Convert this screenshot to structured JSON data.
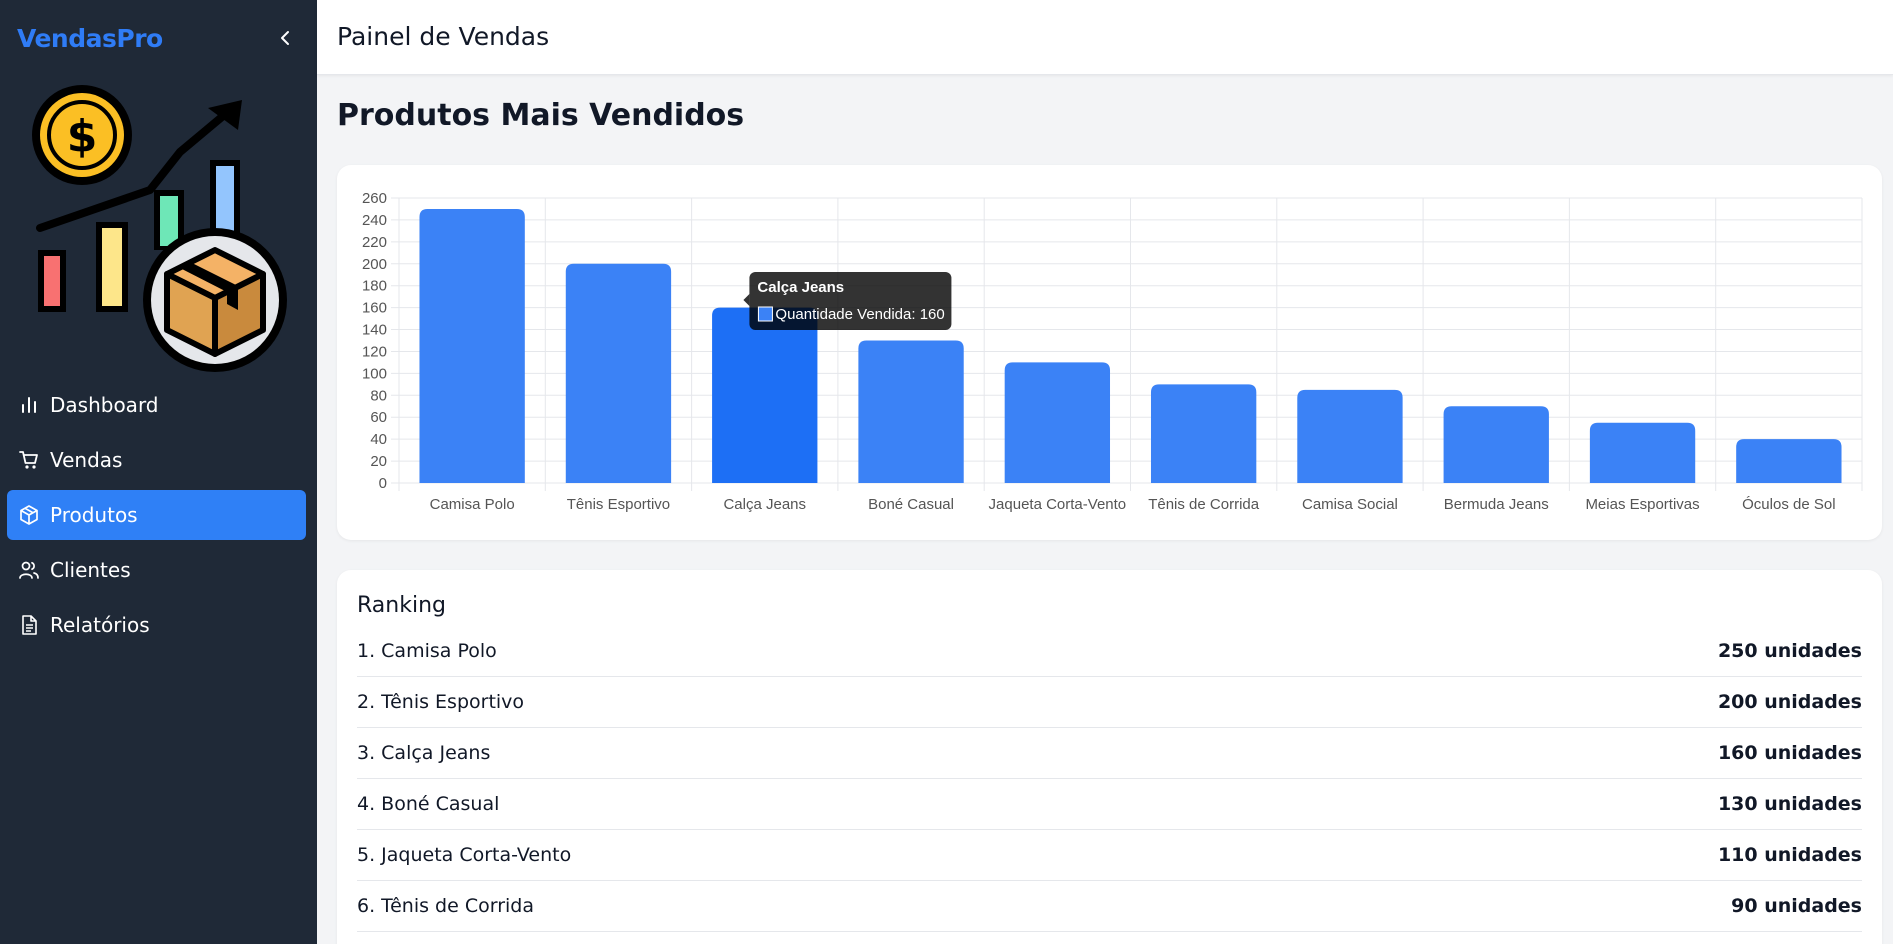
{
  "app": {
    "brand": "VendasPro",
    "header_title": "Painel de Vendas"
  },
  "icons": {
    "collapse": "chevron-left-icon",
    "logo": "sales-growth-logo-icon"
  },
  "colors": {
    "brand": "#2f7cf6",
    "sidebar_bg": "#1f2937",
    "active_nav": "#2f80f6",
    "bar": "#3b82f6",
    "bar_hover": "#1d6ff5"
  },
  "sidebar": {
    "items": [
      {
        "label": "Dashboard",
        "icon": "bar-chart-icon",
        "active": false
      },
      {
        "label": "Vendas",
        "icon": "cart-icon",
        "active": false
      },
      {
        "label": "Produtos",
        "icon": "package-icon",
        "active": true
      },
      {
        "label": "Clientes",
        "icon": "users-icon",
        "active": false
      },
      {
        "label": "Relatórios",
        "icon": "file-text-icon",
        "active": false
      }
    ]
  },
  "main": {
    "page_title": "Produtos Mais Vendidos"
  },
  "chart_data": {
    "type": "bar",
    "categories": [
      "Camisa Polo",
      "Tênis Esportivo",
      "Calça Jeans",
      "Boné Casual",
      "Jaqueta Corta-Vento",
      "Tênis de Corrida",
      "Camisa Social",
      "Bermuda Jeans",
      "Meias Esportivas",
      "Óculos de Sol"
    ],
    "series": [
      {
        "name": "Quantidade Vendida",
        "values": [
          250,
          200,
          160,
          130,
          110,
          90,
          85,
          70,
          55,
          40
        ]
      }
    ],
    "ylim": [
      0,
      260
    ],
    "yticks": [
      0,
      20,
      40,
      60,
      80,
      100,
      120,
      140,
      160,
      180,
      200,
      220,
      240,
      260
    ],
    "grid": true,
    "highlighted_index": 2,
    "tooltip": {
      "title": "Calça Jeans",
      "text": "Quantidade Vendida: 160"
    }
  },
  "ranking": {
    "title": "Ranking",
    "items": [
      {
        "name": "1. Camisa Polo",
        "qty": "250 unidades"
      },
      {
        "name": "2. Tênis Esportivo",
        "qty": "200 unidades"
      },
      {
        "name": "3. Calça Jeans",
        "qty": "160 unidades"
      },
      {
        "name": "4. Boné Casual",
        "qty": "130 unidades"
      },
      {
        "name": "5. Jaqueta Corta-Vento",
        "qty": "110 unidades"
      },
      {
        "name": "6. Tênis de Corrida",
        "qty": "90 unidades"
      }
    ]
  }
}
